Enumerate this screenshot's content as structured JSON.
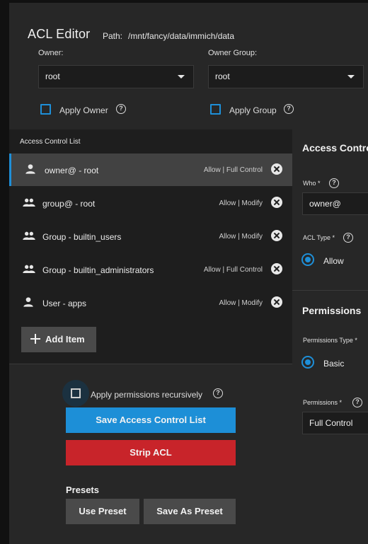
{
  "header": {
    "title": "ACL Editor",
    "path_label": "Path:",
    "path_value": "/mnt/fancy/data/immich/data"
  },
  "owner": {
    "label": "Owner:",
    "value": "root",
    "apply_label": "Apply Owner"
  },
  "owner_group": {
    "label": "Owner Group:",
    "value": "root",
    "apply_label": "Apply Group"
  },
  "acl_list": {
    "header": "Access Control List",
    "items": [
      {
        "name": "owner@ - root",
        "perm": "Allow | Full Control",
        "icon": "user-icon",
        "selected": true
      },
      {
        "name": "group@ - root",
        "perm": "Allow | Modify",
        "icon": "group-icon",
        "selected": false
      },
      {
        "name": "Group - builtin_users",
        "perm": "Allow | Modify",
        "icon": "group-icon",
        "selected": false
      },
      {
        "name": "Group - builtin_administrators",
        "perm": "Allow | Full Control",
        "icon": "group-icon",
        "selected": false
      },
      {
        "name": "User - apps",
        "perm": "Allow | Modify",
        "icon": "user-icon",
        "selected": false
      }
    ],
    "add_item_label": "Add Item"
  },
  "actions": {
    "recursive_label": "Apply permissions recursively",
    "save_label": "Save Access Control List",
    "strip_label": "Strip ACL",
    "presets_title": "Presets",
    "use_preset_label": "Use Preset",
    "save_preset_label": "Save As Preset"
  },
  "entry": {
    "section_title": "Access Contro",
    "who_label": "Who *",
    "who_value": "owner@",
    "acl_type_label": "ACL Type *",
    "acl_type_value": "Allow",
    "permissions_title": "Permissions",
    "permissions_type_label": "Permissions Type *",
    "permissions_type_value": "Basic",
    "permissions_label": "Permissions *",
    "permissions_value": "Full Control"
  },
  "colors": {
    "accent": "#1e8fd8",
    "danger": "#c8242a",
    "panel": "#272727"
  }
}
